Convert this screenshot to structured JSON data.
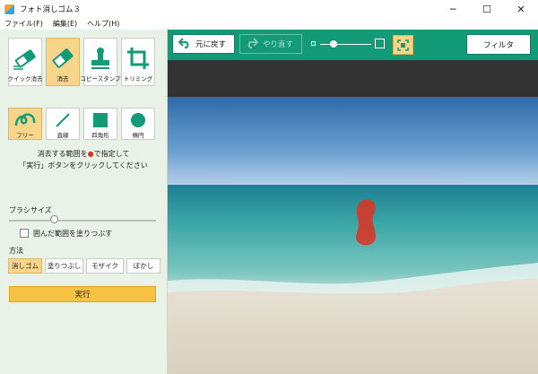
{
  "window": {
    "title": "フォト消しゴム３",
    "minimize": "─",
    "maximize": "☐",
    "close": "✕"
  },
  "menu": [
    {
      "label": "ファイル(F)"
    },
    {
      "label": "編集(E)"
    },
    {
      "label": "ヘルプ(H)"
    }
  ],
  "tools": [
    {
      "label": "クイック消去",
      "icon": "quick-erase-icon",
      "selected": false
    },
    {
      "label": "消去",
      "icon": "eraser-icon",
      "selected": true
    },
    {
      "label": "コピースタンプ",
      "icon": "stamp-icon",
      "selected": false
    },
    {
      "label": "トリミング",
      "icon": "crop-icon",
      "selected": false
    }
  ],
  "shapes": [
    {
      "label": "フリー",
      "icon": "freehand-icon",
      "selected": true
    },
    {
      "label": "直線",
      "icon": "line-icon",
      "selected": false
    },
    {
      "label": "四角形",
      "icon": "rectangle-icon",
      "selected": false
    },
    {
      "label": "楕円",
      "icon": "ellipse-icon",
      "selected": false
    }
  ],
  "instructions": {
    "line1_pre": "消去する範囲を",
    "line1_dot": "●",
    "line1_post": "で指定して",
    "line2": "「実行」ボタンをクリックしてください"
  },
  "brush": {
    "label": "ブラシサイズ",
    "value_fraction": 0.3
  },
  "fill_enclosed": {
    "label": "囲んだ範囲を塗りつぶす",
    "checked": false
  },
  "method": {
    "label": "方法",
    "options": [
      {
        "label": "消しゴム",
        "selected": true
      },
      {
        "label": "塗りつぶし",
        "selected": false
      },
      {
        "label": "モザイク",
        "selected": false
      },
      {
        "label": "ぼかし",
        "selected": false
      }
    ]
  },
  "execute_label": "実行",
  "toolbar": {
    "undo_label": "元に戻す",
    "redo_label": "やり直す",
    "zoom_fraction": 0.2,
    "filter_label": "フィルタ"
  },
  "colors": {
    "accent": "#139a76",
    "selected": "#f7d58a",
    "panel": "#e9f2e7",
    "execute": "#f5c242",
    "mark": "#e03020"
  }
}
